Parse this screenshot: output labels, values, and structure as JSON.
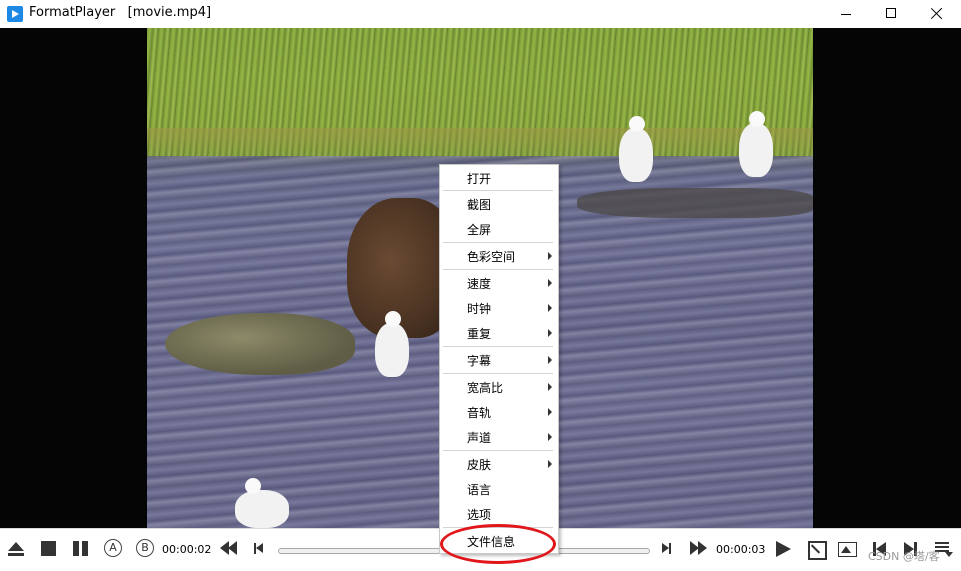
{
  "window": {
    "app_name": "FormatPlayer",
    "title": "FormatPlayer   [movie.mp4]"
  },
  "context_menu": {
    "items": [
      {
        "label": "打开",
        "has_submenu": false
      },
      {
        "label": "截图",
        "has_submenu": false
      },
      {
        "label": "全屏",
        "has_submenu": false
      },
      {
        "label": "色彩空间",
        "has_submenu": true
      },
      {
        "label": "速度",
        "has_submenu": true
      },
      {
        "label": "时钟",
        "has_submenu": true
      },
      {
        "label": "重复",
        "has_submenu": true
      },
      {
        "label": "字幕",
        "has_submenu": true
      },
      {
        "label": "宽高比",
        "has_submenu": true
      },
      {
        "label": "音轨",
        "has_submenu": true
      },
      {
        "label": "声道",
        "has_submenu": true
      },
      {
        "label": "皮肤",
        "has_submenu": true
      },
      {
        "label": "语言",
        "has_submenu": false
      },
      {
        "label": "选项",
        "has_submenu": false
      },
      {
        "label": "文件信息",
        "has_submenu": false
      }
    ],
    "highlighted_item": "文件信息",
    "highlight_color": "#e0161b"
  },
  "controls": {
    "point_a_label": "A",
    "point_b_label": "B",
    "current_time": "00:00:02",
    "total_time": "00:00:03"
  },
  "watermark": "CSDN @塔/客",
  "icons": [
    "eject-icon",
    "stop-icon",
    "pause-icon",
    "rewind-icon",
    "prev-frame-icon",
    "next-frame-icon",
    "fast-forward-icon",
    "play-icon",
    "fullscreen-icon",
    "screenshot-icon",
    "prev-file-icon",
    "next-file-icon",
    "playlist-icon"
  ]
}
